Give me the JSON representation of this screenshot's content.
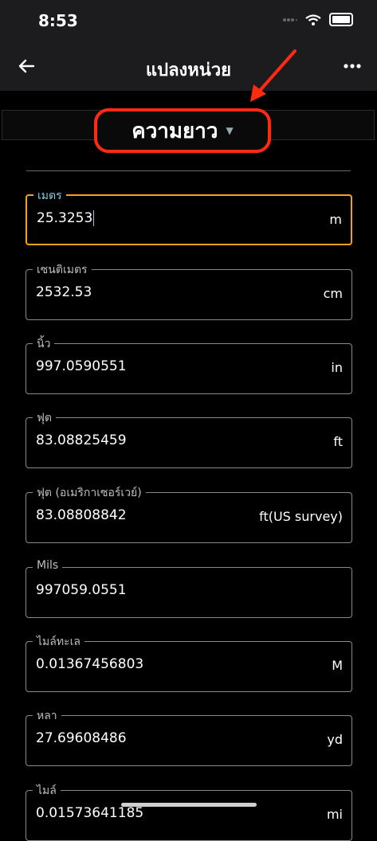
{
  "status": {
    "time": "8:53"
  },
  "header": {
    "title": "แปลงหน่วย"
  },
  "selector": {
    "label": "ความยาว"
  },
  "fields": [
    {
      "label": "เมตร",
      "value": "25.3253",
      "unit": "m"
    },
    {
      "label": "เซนติเมตร",
      "value": "2532.53",
      "unit": "cm"
    },
    {
      "label": "นิ้ว",
      "value": "997.0590551",
      "unit": "in"
    },
    {
      "label": "ฟุต",
      "value": "83.08825459",
      "unit": "ft"
    },
    {
      "label": "ฟุต (อเมริกาเซอร์เวย์)",
      "value": "83.08808842",
      "unit": "ft(US survey)"
    },
    {
      "label": "Mils",
      "value": "997059.0551",
      "unit": ""
    },
    {
      "label": "ไมล์ทะเล",
      "value": "0.01367456803",
      "unit": "M"
    },
    {
      "label": "หลา",
      "value": "27.69608486",
      "unit": "yd"
    },
    {
      "label": "ไมล์",
      "value": "0.01573641185",
      "unit": "mi"
    }
  ],
  "colors": {
    "accent": "#f5a21a",
    "annotation": "#ff2a12",
    "active_label": "#86c9e2"
  }
}
